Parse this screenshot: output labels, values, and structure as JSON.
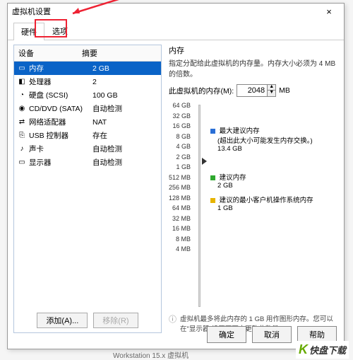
{
  "window": {
    "title": "虚拟机设置"
  },
  "tabs": {
    "hardware": "硬件",
    "options": "选项"
  },
  "hw_header": {
    "device": "设备",
    "summary": "摘要"
  },
  "hw_rows": [
    {
      "icon": "▭",
      "name": "内存",
      "summary": "2 GB",
      "sel": true
    },
    {
      "icon": "◧",
      "name": "处理器",
      "summary": "2"
    },
    {
      "icon": "◔",
      "name": "硬盘 (SCSI)",
      "summary": "100 GB"
    },
    {
      "icon": "◉",
      "name": "CD/DVD (SATA)",
      "summary": "自动检测"
    },
    {
      "icon": "⇄",
      "name": "网络适配器",
      "summary": "NAT"
    },
    {
      "icon": "⎘",
      "name": "USB 控制器",
      "summary": "存在"
    },
    {
      "icon": "♪",
      "name": "声卡",
      "summary": "自动检测"
    },
    {
      "icon": "▭",
      "name": "显示器",
      "summary": "自动检测"
    }
  ],
  "left_buttons": {
    "add": "添加(A)...",
    "remove": "移除(R)"
  },
  "right": {
    "section_title": "内存",
    "section_desc": "指定分配给此虚拟机的内存量。内存大小必须为 4 MB 的倍数。",
    "mem_label": "此虚拟机的内存(M):",
    "mem_value": "2048",
    "mem_unit": "MB",
    "ticks": [
      "64 GB",
      "32 GB",
      "16 GB",
      "8 GB",
      "4 GB",
      "2 GB",
      "1 GB",
      "512 MB",
      "256 MB",
      "128 MB",
      "64 MB",
      "32 MB",
      "16 MB",
      "8 MB",
      "4 MB"
    ],
    "labels": {
      "max": {
        "title": "最大建议内存",
        "sub": "(超出此大小可能发生内存交换。)",
        "val": "13.4 GB",
        "color": "#2a6fd6"
      },
      "rec": {
        "title": "建议内存",
        "val": "2 GB",
        "color": "#2fa82f"
      },
      "min": {
        "title": "建议的最小客户机操作系统内存",
        "val": "1 GB",
        "color": "#e6b400"
      }
    },
    "hint": "虚拟机最多将此内存的 1 GB 用作图形内存。您可以在\"显示器\"设置页面中更改此数量。"
  },
  "dlg": {
    "ok": "确定",
    "cancel": "取消",
    "help": "帮助"
  },
  "footer": {
    "brand": "快盘下载",
    "ws": "Workstation 15.x 虚拟机"
  }
}
